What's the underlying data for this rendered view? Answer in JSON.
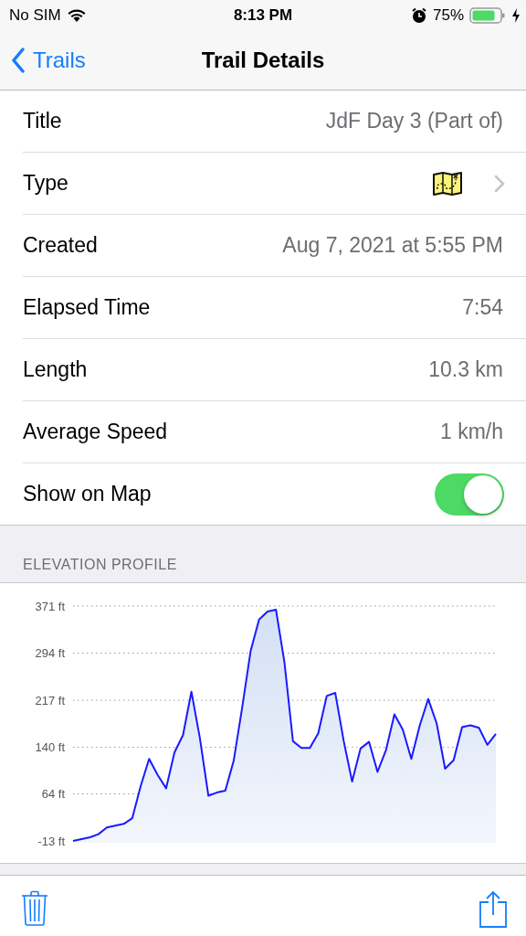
{
  "status_bar": {
    "carrier": "No SIM",
    "time": "8:13 PM",
    "battery": "75%"
  },
  "nav": {
    "back": "Trails",
    "title": "Trail Details"
  },
  "rows": [
    {
      "kind": "value",
      "label": "Title",
      "value": "JdF Day 3 (Part of)"
    },
    {
      "kind": "link",
      "label": "Type"
    },
    {
      "kind": "value",
      "label": "Created",
      "value": "Aug 7, 2021 at 5:55 PM"
    },
    {
      "kind": "value",
      "label": "Elapsed Time",
      "value": "7:54"
    },
    {
      "kind": "value",
      "label": "Length",
      "value": "10.3 km"
    },
    {
      "kind": "value",
      "label": "Average Speed",
      "value": "1 km/h"
    },
    {
      "kind": "toggle",
      "label": "Show on Map",
      "on": true
    }
  ],
  "elevation": {
    "header": "ELEVATION PROFILE",
    "chart_data": {
      "type": "area",
      "categories": [
        null,
        null,
        null,
        null,
        null,
        null,
        null,
        null,
        null,
        null,
        null,
        null,
        null,
        null,
        null,
        null,
        null,
        null,
        null,
        null,
        null,
        null,
        null,
        null,
        null,
        null,
        null,
        null,
        null,
        null,
        null,
        null,
        null,
        null,
        null,
        null,
        null,
        null,
        null,
        null,
        null,
        null,
        null,
        null,
        null,
        null,
        null,
        null,
        null,
        null,
        null
      ],
      "series": [
        {
          "color": "#1a1aff",
          "values": [
            -13,
            -10,
            -7,
            -2,
            9,
            12,
            15,
            24,
            77,
            121,
            95,
            73,
            132,
            160,
            231,
            155,
            61,
            66,
            69,
            118,
            205,
            298,
            349,
            362,
            365,
            279,
            150,
            139,
            139,
            163,
            224,
            229,
            151,
            84,
            138,
            149,
            100,
            135,
            194,
            169,
            121,
            176,
            219,
            179,
            105,
            119,
            173,
            176,
            172,
            144,
            162
          ]
        }
      ],
      "ylim": [
        -13,
        371
      ],
      "grid": true,
      "yticks": [
        {
          "value": 371,
          "label": "371 ft"
        },
        {
          "value": 294,
          "label": "294 ft"
        },
        {
          "value": 217,
          "label": "217 ft"
        },
        {
          "value": 140,
          "label": "140 ft"
        },
        {
          "value": 64,
          "label": "64 ft"
        },
        {
          "value": -13,
          "label": "-13 ft"
        }
      ]
    }
  }
}
